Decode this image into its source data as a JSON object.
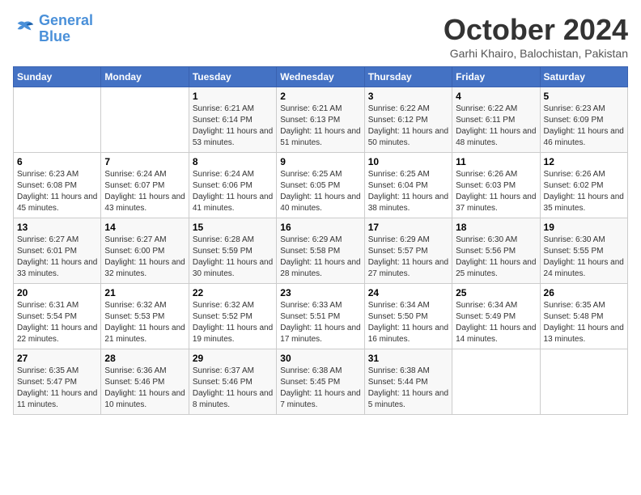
{
  "header": {
    "logo_line1": "General",
    "logo_line2": "Blue",
    "month_title": "October 2024",
    "location": "Garhi Khairo, Balochistan, Pakistan"
  },
  "days_of_week": [
    "Sunday",
    "Monday",
    "Tuesday",
    "Wednesday",
    "Thursday",
    "Friday",
    "Saturday"
  ],
  "weeks": [
    [
      {
        "day": "",
        "info": ""
      },
      {
        "day": "",
        "info": ""
      },
      {
        "day": "1",
        "info": "Sunrise: 6:21 AM\nSunset: 6:14 PM\nDaylight: 11 hours and 53 minutes."
      },
      {
        "day": "2",
        "info": "Sunrise: 6:21 AM\nSunset: 6:13 PM\nDaylight: 11 hours and 51 minutes."
      },
      {
        "day": "3",
        "info": "Sunrise: 6:22 AM\nSunset: 6:12 PM\nDaylight: 11 hours and 50 minutes."
      },
      {
        "day": "4",
        "info": "Sunrise: 6:22 AM\nSunset: 6:11 PM\nDaylight: 11 hours and 48 minutes."
      },
      {
        "day": "5",
        "info": "Sunrise: 6:23 AM\nSunset: 6:09 PM\nDaylight: 11 hours and 46 minutes."
      }
    ],
    [
      {
        "day": "6",
        "info": "Sunrise: 6:23 AM\nSunset: 6:08 PM\nDaylight: 11 hours and 45 minutes."
      },
      {
        "day": "7",
        "info": "Sunrise: 6:24 AM\nSunset: 6:07 PM\nDaylight: 11 hours and 43 minutes."
      },
      {
        "day": "8",
        "info": "Sunrise: 6:24 AM\nSunset: 6:06 PM\nDaylight: 11 hours and 41 minutes."
      },
      {
        "day": "9",
        "info": "Sunrise: 6:25 AM\nSunset: 6:05 PM\nDaylight: 11 hours and 40 minutes."
      },
      {
        "day": "10",
        "info": "Sunrise: 6:25 AM\nSunset: 6:04 PM\nDaylight: 11 hours and 38 minutes."
      },
      {
        "day": "11",
        "info": "Sunrise: 6:26 AM\nSunset: 6:03 PM\nDaylight: 11 hours and 37 minutes."
      },
      {
        "day": "12",
        "info": "Sunrise: 6:26 AM\nSunset: 6:02 PM\nDaylight: 11 hours and 35 minutes."
      }
    ],
    [
      {
        "day": "13",
        "info": "Sunrise: 6:27 AM\nSunset: 6:01 PM\nDaylight: 11 hours and 33 minutes."
      },
      {
        "day": "14",
        "info": "Sunrise: 6:27 AM\nSunset: 6:00 PM\nDaylight: 11 hours and 32 minutes."
      },
      {
        "day": "15",
        "info": "Sunrise: 6:28 AM\nSunset: 5:59 PM\nDaylight: 11 hours and 30 minutes."
      },
      {
        "day": "16",
        "info": "Sunrise: 6:29 AM\nSunset: 5:58 PM\nDaylight: 11 hours and 28 minutes."
      },
      {
        "day": "17",
        "info": "Sunrise: 6:29 AM\nSunset: 5:57 PM\nDaylight: 11 hours and 27 minutes."
      },
      {
        "day": "18",
        "info": "Sunrise: 6:30 AM\nSunset: 5:56 PM\nDaylight: 11 hours and 25 minutes."
      },
      {
        "day": "19",
        "info": "Sunrise: 6:30 AM\nSunset: 5:55 PM\nDaylight: 11 hours and 24 minutes."
      }
    ],
    [
      {
        "day": "20",
        "info": "Sunrise: 6:31 AM\nSunset: 5:54 PM\nDaylight: 11 hours and 22 minutes."
      },
      {
        "day": "21",
        "info": "Sunrise: 6:32 AM\nSunset: 5:53 PM\nDaylight: 11 hours and 21 minutes."
      },
      {
        "day": "22",
        "info": "Sunrise: 6:32 AM\nSunset: 5:52 PM\nDaylight: 11 hours and 19 minutes."
      },
      {
        "day": "23",
        "info": "Sunrise: 6:33 AM\nSunset: 5:51 PM\nDaylight: 11 hours and 17 minutes."
      },
      {
        "day": "24",
        "info": "Sunrise: 6:34 AM\nSunset: 5:50 PM\nDaylight: 11 hours and 16 minutes."
      },
      {
        "day": "25",
        "info": "Sunrise: 6:34 AM\nSunset: 5:49 PM\nDaylight: 11 hours and 14 minutes."
      },
      {
        "day": "26",
        "info": "Sunrise: 6:35 AM\nSunset: 5:48 PM\nDaylight: 11 hours and 13 minutes."
      }
    ],
    [
      {
        "day": "27",
        "info": "Sunrise: 6:35 AM\nSunset: 5:47 PM\nDaylight: 11 hours and 11 minutes."
      },
      {
        "day": "28",
        "info": "Sunrise: 6:36 AM\nSunset: 5:46 PM\nDaylight: 11 hours and 10 minutes."
      },
      {
        "day": "29",
        "info": "Sunrise: 6:37 AM\nSunset: 5:46 PM\nDaylight: 11 hours and 8 minutes."
      },
      {
        "day": "30",
        "info": "Sunrise: 6:38 AM\nSunset: 5:45 PM\nDaylight: 11 hours and 7 minutes."
      },
      {
        "day": "31",
        "info": "Sunrise: 6:38 AM\nSunset: 5:44 PM\nDaylight: 11 hours and 5 minutes."
      },
      {
        "day": "",
        "info": ""
      },
      {
        "day": "",
        "info": ""
      }
    ]
  ]
}
